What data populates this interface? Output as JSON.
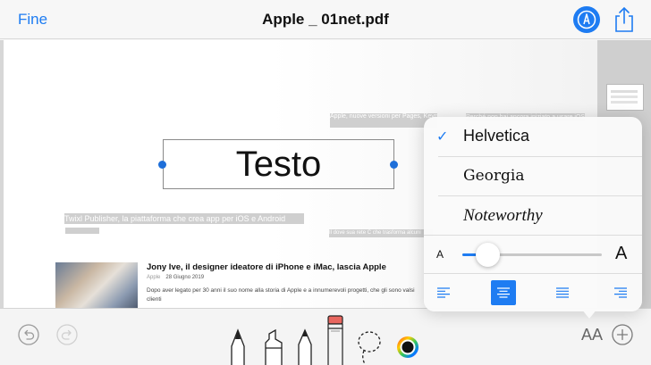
{
  "nav": {
    "done_label": "Fine",
    "title": "Apple _ 01net.pdf",
    "markup_icon": "markup-pen-icon",
    "share_icon": "share-icon"
  },
  "document": {
    "textbox_text": "Testo",
    "faded_fragments": [
      "Apple, nuove versioni per Pages, Keynote e Numbers",
      "Perché non hai ancora iniziato a usare iOS",
      "Twixl Publisher, la piattaforma che crea app per iOS e Android",
      "Il dove sua rete C che trasforma alcuni"
    ],
    "article": {
      "title": "Jony Ive, il designer ideatore di iPhone e iMac, lascia Apple",
      "source": "Apple",
      "date": "28 Giugno 2019",
      "body": "Dopo aver legato per 30 anni il suo nome alla storia di Apple e a innumerevoli progetti, che gli sono valsi clienti"
    }
  },
  "font_popover": {
    "fonts": [
      {
        "label": "Helvetica",
        "selected": true
      },
      {
        "label": "Georgia",
        "selected": false
      },
      {
        "label": "Noteworthy",
        "selected": false
      }
    ],
    "size_small_label": "A",
    "size_large_label": "A",
    "size_level": 0.18,
    "alignment_options": [
      "left",
      "center",
      "justify",
      "right"
    ],
    "selected_alignment": "center"
  },
  "toolbar": {
    "tools": [
      "undo-icon",
      "redo-icon",
      "pen-icon",
      "highlighter-icon",
      "pencil-icon",
      "eraser-icon",
      "lasso-icon",
      "color-picker-icon",
      "font-size-icon",
      "add-icon"
    ],
    "font_size_label": "AA"
  },
  "colors": {
    "accent": "#1e7cf2",
    "handle": "#1e6fd9"
  }
}
